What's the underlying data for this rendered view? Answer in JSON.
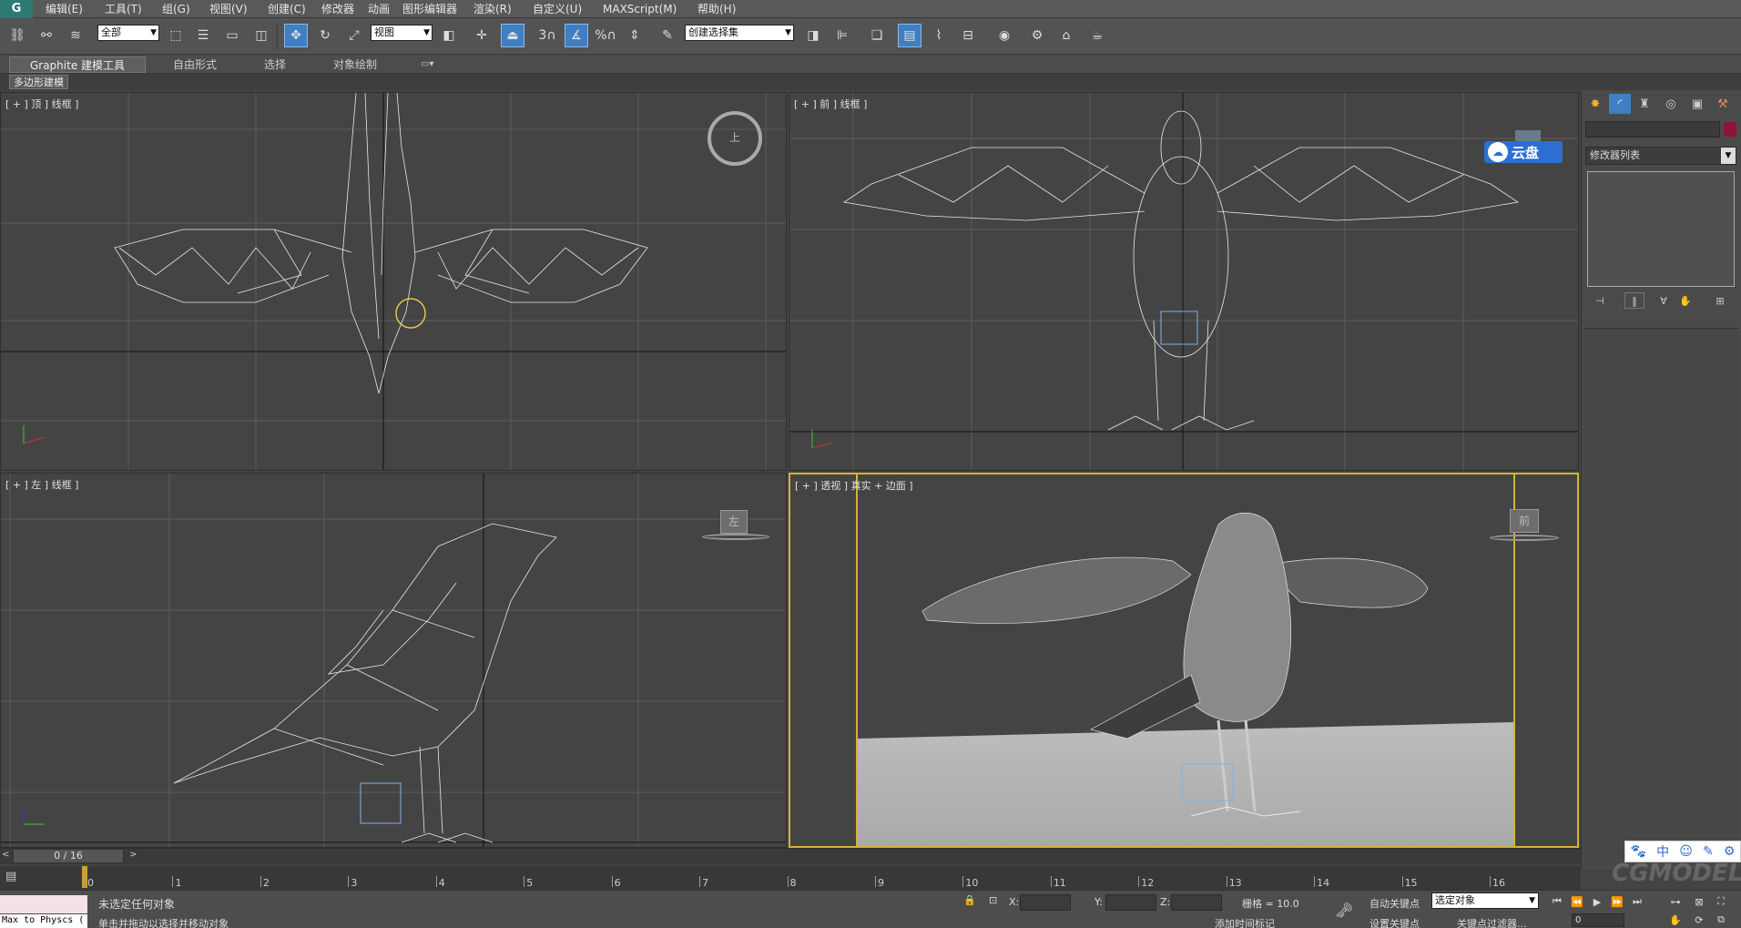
{
  "menu": {
    "logo": "G",
    "items": [
      "编辑(E)",
      "工具(T)",
      "组(G)",
      "视图(V)",
      "创建(C)",
      "修改器",
      "动画",
      "图形编辑器",
      "渲染(R)",
      "自定义(U)",
      "MAXScript(M)",
      "帮助(H)"
    ]
  },
  "toolbar": {
    "selection_filter": "全部",
    "reference_coord": "视图",
    "named_selection_set": "创建选择集",
    "snap_label": "3",
    "percent_snap": "%"
  },
  "ribbon": {
    "tabs": [
      "Graphite 建模工具",
      "自由形式",
      "选择",
      "对象绘制"
    ],
    "subtab": "多边形建模"
  },
  "viewports": {
    "top": {
      "label": "[ + ] 顶 ] 线框 ]",
      "cube": "上"
    },
    "front": {
      "label": "[ + ] 前 ] 线框 ]"
    },
    "left": {
      "label": "[ + ] 左 ] 线框 ]",
      "cube": "左"
    },
    "persp": {
      "label": "[ + ] 透视 ] 真实 + 边面 ]",
      "cube": "前"
    }
  },
  "cloud": {
    "label": "云盘"
  },
  "command_panel": {
    "modifier_list": "修改器列表"
  },
  "timeline": {
    "frame_counter": "0 / 16",
    "labels": [
      "0",
      "1",
      "2",
      "3",
      "4",
      "5",
      "6",
      "7",
      "8",
      "9",
      "10",
      "11",
      "12",
      "13",
      "14",
      "15",
      "16"
    ]
  },
  "status": {
    "maxscript": "Max to Physcs (",
    "selection": "未选定任何对象",
    "prompt": "单击并拖动以选择并移动对象",
    "x_label": "X:",
    "y_label": "Y:",
    "z_label": "Z:",
    "grid": "栅格 = 10.0",
    "auto_key": "自动关键点",
    "set_key": "设置关键点",
    "key_mode": "选定对象",
    "add_time_tag": "添加时间标记",
    "key_filters": "关键点过滤器...",
    "current_frame": "0"
  },
  "ime": {
    "lang": "中"
  },
  "watermark": "CGMODEL.CN"
}
